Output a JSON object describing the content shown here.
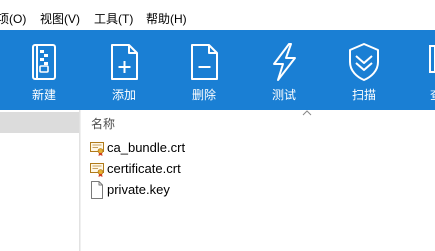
{
  "menu": {
    "items": [
      {
        "label": "项(O)"
      },
      {
        "label": "视图(V)"
      },
      {
        "label": "工具(T)"
      },
      {
        "label": "帮助(H)"
      }
    ]
  },
  "toolbar": {
    "background": "#1a7fd4",
    "buttons": [
      {
        "label": "新建",
        "icon": "archive-zip-icon"
      },
      {
        "label": "添加",
        "icon": "add-file-icon"
      },
      {
        "label": "删除",
        "icon": "delete-file-icon"
      },
      {
        "label": "测试",
        "icon": "lightning-icon"
      },
      {
        "label": "扫描",
        "icon": "shield-scan-icon"
      },
      {
        "label": "查",
        "icon": "overflow-icon"
      }
    ]
  },
  "file_list": {
    "column_header": "名称",
    "files": [
      {
        "name": "ca_bundle.crt",
        "icon": "certificate-icon"
      },
      {
        "name": "certificate.crt",
        "icon": "certificate-icon"
      },
      {
        "name": "private.key",
        "icon": "file-icon"
      }
    ]
  }
}
